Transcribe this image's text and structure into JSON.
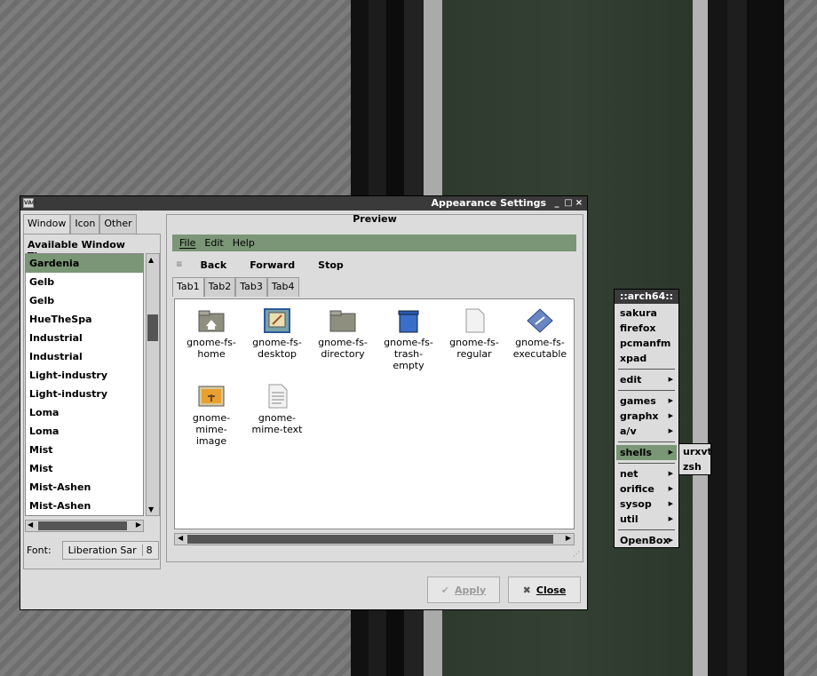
{
  "window": {
    "title": "Appearance Settings",
    "icon_text": "VAO",
    "controls": {
      "minimize": "_",
      "maximize": "□",
      "close": "×"
    }
  },
  "left_panel": {
    "tabs": [
      "Window",
      "Icon",
      "Other"
    ],
    "themes_label": "Available Window Themes",
    "themes": [
      "Gardenia",
      "Gelb",
      "Gelb",
      "HueTheSpa",
      "Industrial",
      "Industrial",
      "Light-industry",
      "Light-industry",
      "Loma",
      "Loma",
      "Mist",
      "Mist",
      "Mist-Ashen",
      "Mist-Ashen"
    ],
    "selected_theme": "Gardenia",
    "font_label": "Font:",
    "font_name": "Liberation Sar",
    "font_size": "8"
  },
  "preview": {
    "title": "Preview",
    "menu": [
      "File",
      "Edit",
      "Help"
    ],
    "toolbar": [
      "Back",
      "Forward",
      "Stop"
    ],
    "toolbar_grip": "≡",
    "tabs": [
      "Tab1",
      "Tab2",
      "Tab3",
      "Tab4"
    ],
    "icons": [
      {
        "label": "gnome-fs-home",
        "lines": [
          "gnome-fs-",
          "home"
        ],
        "icon": "home-folder-icon"
      },
      {
        "label": "gnome-fs-desktop",
        "lines": [
          "gnome-fs-",
          "desktop"
        ],
        "icon": "desktop-icon"
      },
      {
        "label": "gnome-fs-directory",
        "lines": [
          "gnome-fs-",
          "directory"
        ],
        "icon": "folder-icon"
      },
      {
        "label": "gnome-fs-trash-empty",
        "lines": [
          "gnome-fs-",
          "trash-",
          "empty"
        ],
        "icon": "trash-icon"
      },
      {
        "label": "gnome-fs-regular",
        "lines": [
          "gnome-fs-",
          "regular"
        ],
        "icon": "file-icon"
      },
      {
        "label": "gnome-fs-executable",
        "lines": [
          "gnome-fs-",
          "executable"
        ],
        "icon": "executable-icon"
      },
      {
        "label": "gnome-mime-image",
        "lines": [
          "gnome-",
          "mime-",
          "image"
        ],
        "icon": "image-icon"
      },
      {
        "label": "gnome-mime-text",
        "lines": [
          "gnome-",
          "mime-text"
        ],
        "icon": "text-file-icon"
      }
    ]
  },
  "buttons": {
    "apply": "Apply",
    "close": "Close",
    "apply_glyph": "✔",
    "close_glyph": "✖"
  },
  "scroll_glyphs": {
    "up": "▲",
    "down": "▼",
    "left": "◀",
    "right": "▶",
    "submenu": "▶",
    "resize": "⋰"
  },
  "openbox_menu": {
    "title": "::arch64::",
    "items": [
      {
        "label": "sakura",
        "submenu": false
      },
      {
        "label": "firefox",
        "submenu": false
      },
      {
        "label": "pcmanfm",
        "submenu": false
      },
      {
        "label": "xpad",
        "submenu": false
      },
      {
        "sep": true
      },
      {
        "label": "edit",
        "submenu": true
      },
      {
        "sep": true
      },
      {
        "label": "games",
        "submenu": true
      },
      {
        "label": "graphx",
        "submenu": true
      },
      {
        "label": "a/v",
        "submenu": true
      },
      {
        "sep": true
      },
      {
        "label": "shells",
        "submenu": true,
        "selected": true
      },
      {
        "sep": true
      },
      {
        "label": "net",
        "submenu": true
      },
      {
        "label": "orifice",
        "submenu": true
      },
      {
        "label": "sysop",
        "submenu": true
      },
      {
        "label": "util",
        "submenu": true
      },
      {
        "sep": true
      },
      {
        "label": "OpenBox",
        "submenu": true
      }
    ],
    "shells_submenu": [
      "urxvt",
      "zsh"
    ]
  },
  "colors": {
    "accent": "#7a9676",
    "titlebar": "#3a3a3a",
    "window_bg": "#dcdcdc"
  }
}
